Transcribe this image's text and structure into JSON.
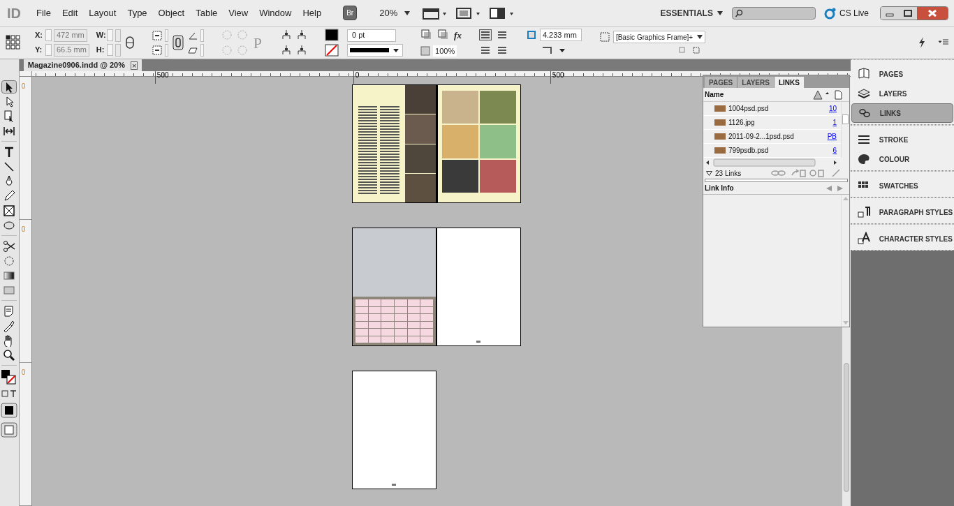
{
  "app_logo": "ID",
  "menu": [
    "File",
    "Edit",
    "Layout",
    "Type",
    "Object",
    "Table",
    "View",
    "Window",
    "Help"
  ],
  "bridge_button": "Br",
  "zoom": "20%",
  "workspace": "ESSENTIALS",
  "cs_live": "CS Live",
  "control_bar": {
    "x_label": "X:",
    "x": "472 mm",
    "y_label": "Y:",
    "y": "66.5 mm",
    "w_label": "W:",
    "h_label": "H:",
    "stroke_weight": "0 pt",
    "opacity": "100%",
    "effects_label": "fx",
    "corner_size": "4.233 mm",
    "object_style": "[Basic Graphics Frame]+",
    "p_glyph": "P"
  },
  "document_tab": {
    "title": "Magazine0906.indd @ 20%",
    "close": "×"
  },
  "ruler_labels": [
    "500",
    "0",
    "500"
  ],
  "vertical_ruler_labels": [
    "0",
    "0",
    "0"
  ],
  "tools": [
    {
      "selected": true
    },
    {
      "selected": false
    },
    {
      "selected": false
    },
    {
      "selected": false
    },
    {
      "selected": false
    },
    {
      "selected": false
    },
    {
      "selected": false
    },
    {
      "selected": false
    },
    {
      "selected": false
    },
    {
      "selected": false
    },
    {
      "selected": false
    },
    {
      "selected": false
    },
    {
      "selected": false
    },
    {
      "selected": false
    },
    {
      "selected": false
    },
    {
      "selected": false
    },
    {
      "selected": false
    },
    {
      "selected": false
    }
  ],
  "spreads": [
    {
      "pages": [
        {
          "kind": "text-photos"
        },
        {
          "kind": "photo-grid"
        }
      ]
    },
    {
      "pages": [
        {
          "kind": "poster"
        },
        {
          "kind": "blank"
        }
      ]
    },
    {
      "pages": [
        {
          "kind": "blank"
        }
      ]
    }
  ],
  "links_panel": {
    "tabs": [
      {
        "label": "PAGES",
        "selected": false
      },
      {
        "label": "LAYERS",
        "selected": false
      },
      {
        "label": "LINKS",
        "selected": true
      }
    ],
    "name_header": "Name",
    "links": [
      {
        "name": "1004psd.psd",
        "page": "10"
      },
      {
        "name": "1126.jpg",
        "page": "1"
      },
      {
        "name": "2011-09-2...1psd.psd",
        "page": "PB"
      },
      {
        "name": "799psdb.psd",
        "page": "6"
      }
    ],
    "count": "23 Links",
    "link_info": "Link Info"
  },
  "dock": [
    {
      "label": "PAGES",
      "selected": false
    },
    {
      "label": "LAYERS",
      "selected": false
    },
    {
      "label": "LINKS",
      "selected": true
    },
    {
      "label": "STROKE",
      "selected": false
    },
    {
      "label": "COLOUR",
      "selected": false
    },
    {
      "label": "SWATCHES",
      "selected": false
    },
    {
      "label": "PARAGRAPH STYLES",
      "selected": false
    },
    {
      "label": "CHARACTER STYLES",
      "selected": false
    }
  ]
}
